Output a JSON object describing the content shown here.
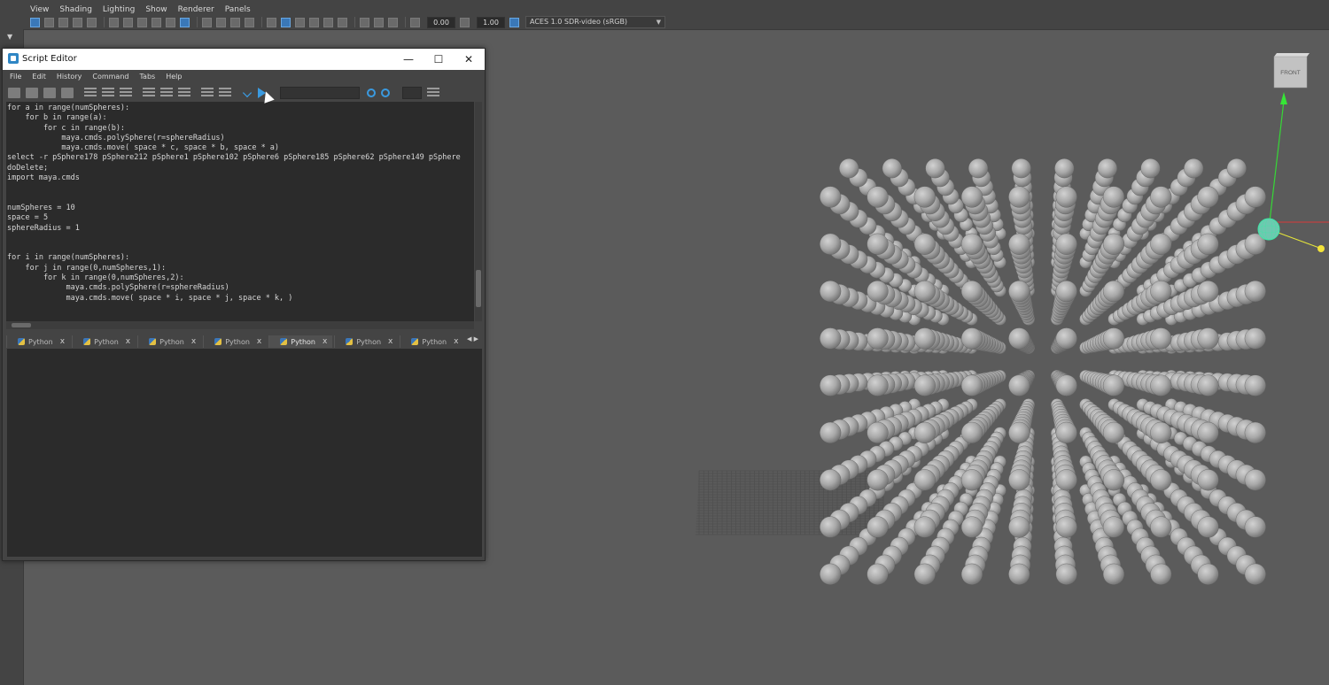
{
  "panel_menu": [
    "View",
    "Shading",
    "Lighting",
    "Show",
    "Renderer",
    "Panels"
  ],
  "panel_toolbar": {
    "exposure": "0.00",
    "gamma": "1.00",
    "color_space": "ACES 1.0 SDR-video (sRGB)"
  },
  "view_cube": {
    "label": "FRONT"
  },
  "script_editor": {
    "title": "Script Editor",
    "window_controls": {
      "minimize": "—",
      "maximize": "☐",
      "close": "✕"
    },
    "menu": [
      "File",
      "Edit",
      "History",
      "Command",
      "Tabs",
      "Help"
    ],
    "code_lines": [
      "for a in range(numSpheres):",
      "    for b in range(a):",
      "        for c in range(b):",
      "            maya.cmds.polySphere(r=sphereRadius)",
      "            maya.cmds.move( space * c, space * b, space * a)",
      "select -r pSphere178 pSphere212 pSphere1 pSphere102 pSphere6 pSphere185 pSphere62 pSphere149 pSphere",
      "doDelete;",
      "import maya.cmds",
      "",
      "",
      "numSpheres = 10",
      "space = 5",
      "sphereRadius = 1",
      "",
      "",
      "for i in range(numSpheres):",
      "    for j in range(0,numSpheres,1):",
      "        for k in range(0,numSpheres,2):",
      "             maya.cmds.polySphere(r=sphereRadius)",
      "             maya.cmds.move( space * i, space * j, space * k, )"
    ],
    "tabs": [
      {
        "label": "Python",
        "close": "x",
        "active": false
      },
      {
        "label": "Python",
        "close": "x",
        "active": false
      },
      {
        "label": "Python",
        "close": "x",
        "active": false
      },
      {
        "label": "Python",
        "close": "x",
        "active": false
      },
      {
        "label": "Python",
        "close": "x",
        "active": true
      },
      {
        "label": "Python",
        "close": "x",
        "active": false
      },
      {
        "label": "Python",
        "close": "x",
        "active": false
      }
    ]
  }
}
